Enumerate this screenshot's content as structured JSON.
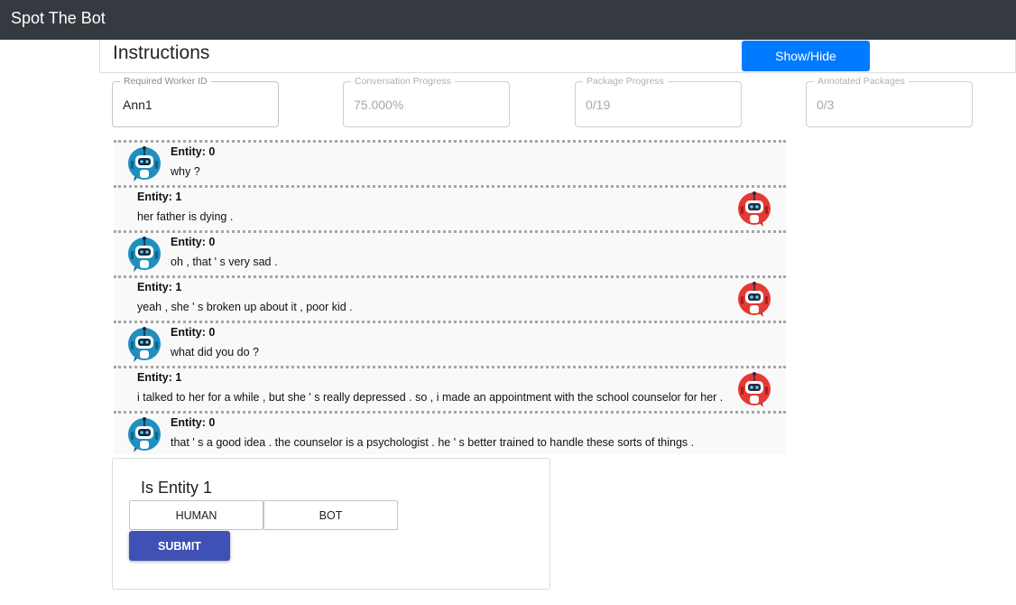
{
  "app": {
    "title": "Spot The Bot"
  },
  "instructions": {
    "title": "Instructions",
    "toggle_label": "Show/Hide"
  },
  "fields": {
    "worker_id": {
      "label": "Required Worker ID",
      "value": "Ann1"
    },
    "conversation_progress": {
      "label": "Conversation Progress",
      "value": "75.000%"
    },
    "package_progress": {
      "label": "Package Progress",
      "value": "0/19"
    },
    "annotated_packages": {
      "label": "Annotated Packages",
      "value": "0/3"
    }
  },
  "conversation": [
    {
      "entity": "Entity: 0",
      "text": "why ?",
      "avatar": "blue-robot-icon"
    },
    {
      "entity": "Entity: 1",
      "text": "her father is dying .",
      "avatar": "red-robot-icon"
    },
    {
      "entity": "Entity: 0",
      "text": "oh , that ' s very sad .",
      "avatar": "blue-robot-icon"
    },
    {
      "entity": "Entity: 1",
      "text": "yeah , she ' s broken up about it , poor kid .",
      "avatar": "red-robot-icon"
    },
    {
      "entity": "Entity: 0",
      "text": "what did you do ?",
      "avatar": "blue-robot-icon"
    },
    {
      "entity": "Entity: 1",
      "text": "i talked to her for a while , but she ' s really depressed . so , i made an appointment with the school counselor for her .",
      "avatar": "red-robot-icon"
    },
    {
      "entity": "Entity: 0",
      "text": "that ' s a good idea . the counselor is a psychologist . he ' s better trained to handle these sorts of things .",
      "avatar": "blue-robot-icon"
    }
  ],
  "vote": {
    "question": "Is Entity 1",
    "human_label": "HUMAN",
    "bot_label": "BOT",
    "submit_label": "SUBMIT"
  },
  "colors": {
    "navbar": "#343a40",
    "primary": "#007bff",
    "submit": "#3f51b5",
    "entity0_avatar": "#1f8fbf",
    "entity1_avatar": "#e53935"
  }
}
